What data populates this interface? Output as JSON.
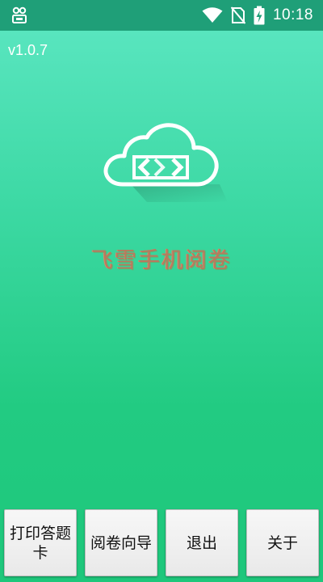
{
  "status_bar": {
    "time": "10:18",
    "icons": [
      "app-notification-icon",
      "wifi-icon",
      "no-sim-icon",
      "battery-charging-icon"
    ]
  },
  "app": {
    "version": "v1.0.7",
    "title": "飞雪手机阅卷",
    "logo": "cloud-logo-icon"
  },
  "buttons": {
    "print_card": "打印答题卡",
    "grading_wizard": "阅卷向导",
    "exit": "退出",
    "about": "关于"
  },
  "colors": {
    "status_bar": "#1f9f78",
    "background_top": "#5de7c3",
    "background_bottom": "#1ec77b",
    "title_text": "#b87a5e",
    "button_bg": "#f0f0f0"
  }
}
